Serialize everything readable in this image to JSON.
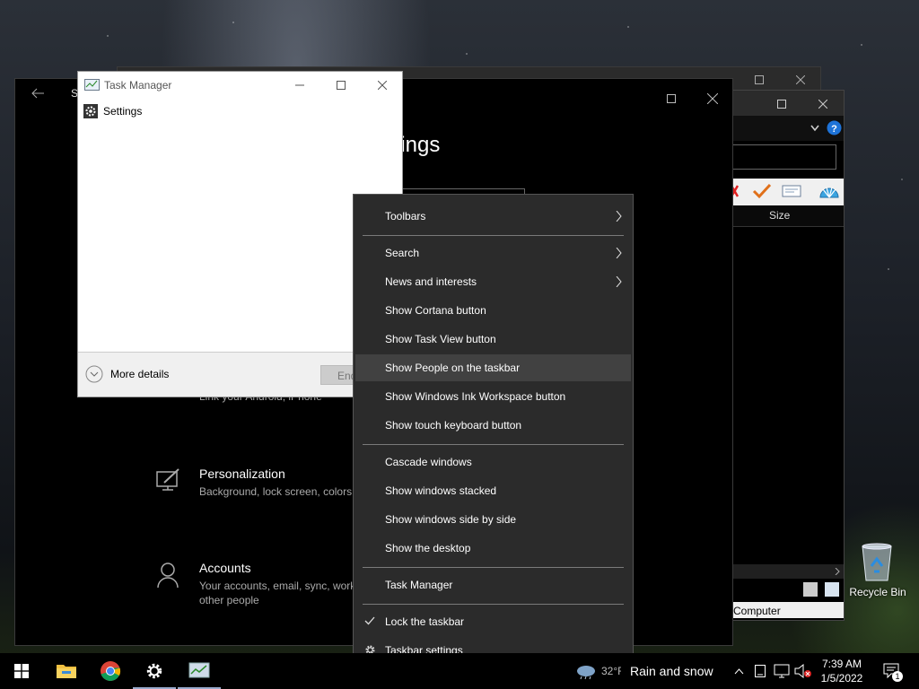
{
  "task_manager": {
    "title": "Task Manager",
    "app_item": "Settings",
    "more_details": "More details",
    "end_task_partial": "End"
  },
  "settings_window": {
    "heading_partial": "ttings",
    "title_partial": "S",
    "phone_desc_partial": "Link your Android, iPhone",
    "categories": [
      {
        "title": "Personalization",
        "desc": "Background, lock screen, colors",
        "icon": "personalization-icon"
      },
      {
        "title": "Accounts",
        "desc": "Your accounts, email, sync, work, other people",
        "icon": "accounts-icon"
      }
    ]
  },
  "context_menu": {
    "items": [
      {
        "label": "Toolbars",
        "submenu": true
      },
      {
        "label": "Search",
        "submenu": true
      },
      {
        "label": "News and interests",
        "submenu": true
      },
      {
        "label": "Show Cortana button"
      },
      {
        "label": "Show Task View button"
      },
      {
        "label": "Show People on the taskbar",
        "highlighted": true
      },
      {
        "label": "Show Windows Ink Workspace button"
      },
      {
        "label": "Show touch keyboard button"
      },
      {
        "label": "Cascade windows"
      },
      {
        "label": "Show windows stacked"
      },
      {
        "label": "Show windows side by side"
      },
      {
        "label": "Show the desktop"
      },
      {
        "label": "Task Manager"
      },
      {
        "label": "Lock the taskbar",
        "checked": true
      },
      {
        "label": "Taskbar settings",
        "icon": "gear-icon"
      }
    ]
  },
  "explorer": {
    "column_size": "Size",
    "status_computer": "Computer"
  },
  "desktop": {
    "recycle_bin_label": "Recycle Bin"
  },
  "taskbar": {
    "pinned": [
      "start-icon",
      "file-explorer-icon",
      "chrome-icon",
      "settings-icon",
      "task-manager-icon"
    ],
    "weather_temp_partial": "32°F",
    "weather_text": "Rain and snow",
    "time": "7:39 AM",
    "date": "1/5/2022",
    "notification_count": "1"
  },
  "colors": {
    "menu_bg": "#2b2b2b",
    "menu_highlight": "#414141",
    "taskbar_bg": "#000000",
    "window_bg": "#000000"
  }
}
